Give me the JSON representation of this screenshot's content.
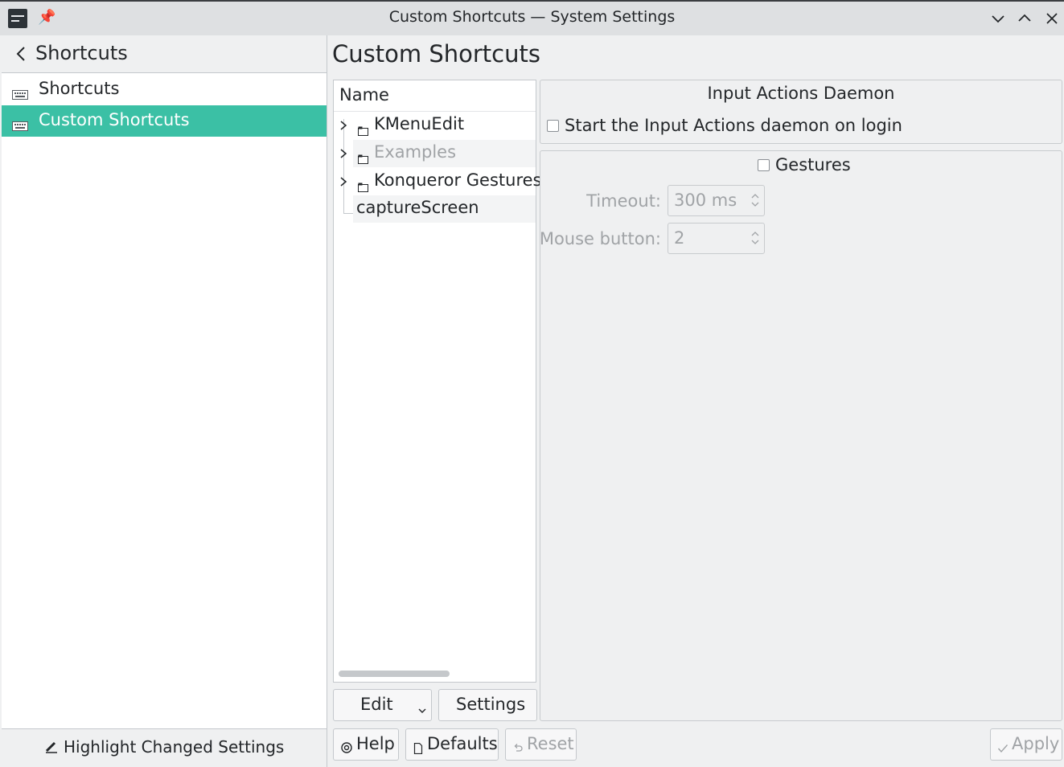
{
  "window": {
    "title": "Custom Shortcuts — System Settings"
  },
  "sidebar": {
    "title": "Shortcuts",
    "items": [
      {
        "label": "Shortcuts",
        "selected": false
      },
      {
        "label": "Custom Shortcuts",
        "selected": true
      }
    ],
    "footer_label": "Highlight Changed Settings"
  },
  "main": {
    "title": "Custom Shortcuts",
    "tree": {
      "header": "Name",
      "rows": [
        {
          "label": "KMenuEdit",
          "expandable": true,
          "folder": true,
          "enabled": true
        },
        {
          "label": "Examples",
          "expandable": true,
          "folder": true,
          "enabled": false
        },
        {
          "label": "Konqueror Gestures",
          "expandable": true,
          "folder": true,
          "enabled": true
        },
        {
          "label": "captureScreen",
          "expandable": false,
          "folder": false,
          "enabled": true
        }
      ]
    },
    "tree_buttons": {
      "edit": "Edit",
      "settings": "Settings"
    },
    "daemon": {
      "title": "Input Actions Daemon",
      "checkbox_label": "Start the Input Actions daemon on login",
      "checked": false
    },
    "gestures": {
      "checkbox_label": "Gestures",
      "checked": false,
      "timeout_label": "Timeout:",
      "timeout_value": "300 ms",
      "mouse_button_label": "Mouse button:",
      "mouse_button_value": "2"
    }
  },
  "footer": {
    "help": "Help",
    "defaults": "Defaults",
    "reset": "Reset",
    "apply": "Apply"
  },
  "colors": {
    "accent": "#3bc0a5",
    "window_bg": "#eff0f1",
    "text": "#232629",
    "disabled_text": "#a0a3a6"
  }
}
